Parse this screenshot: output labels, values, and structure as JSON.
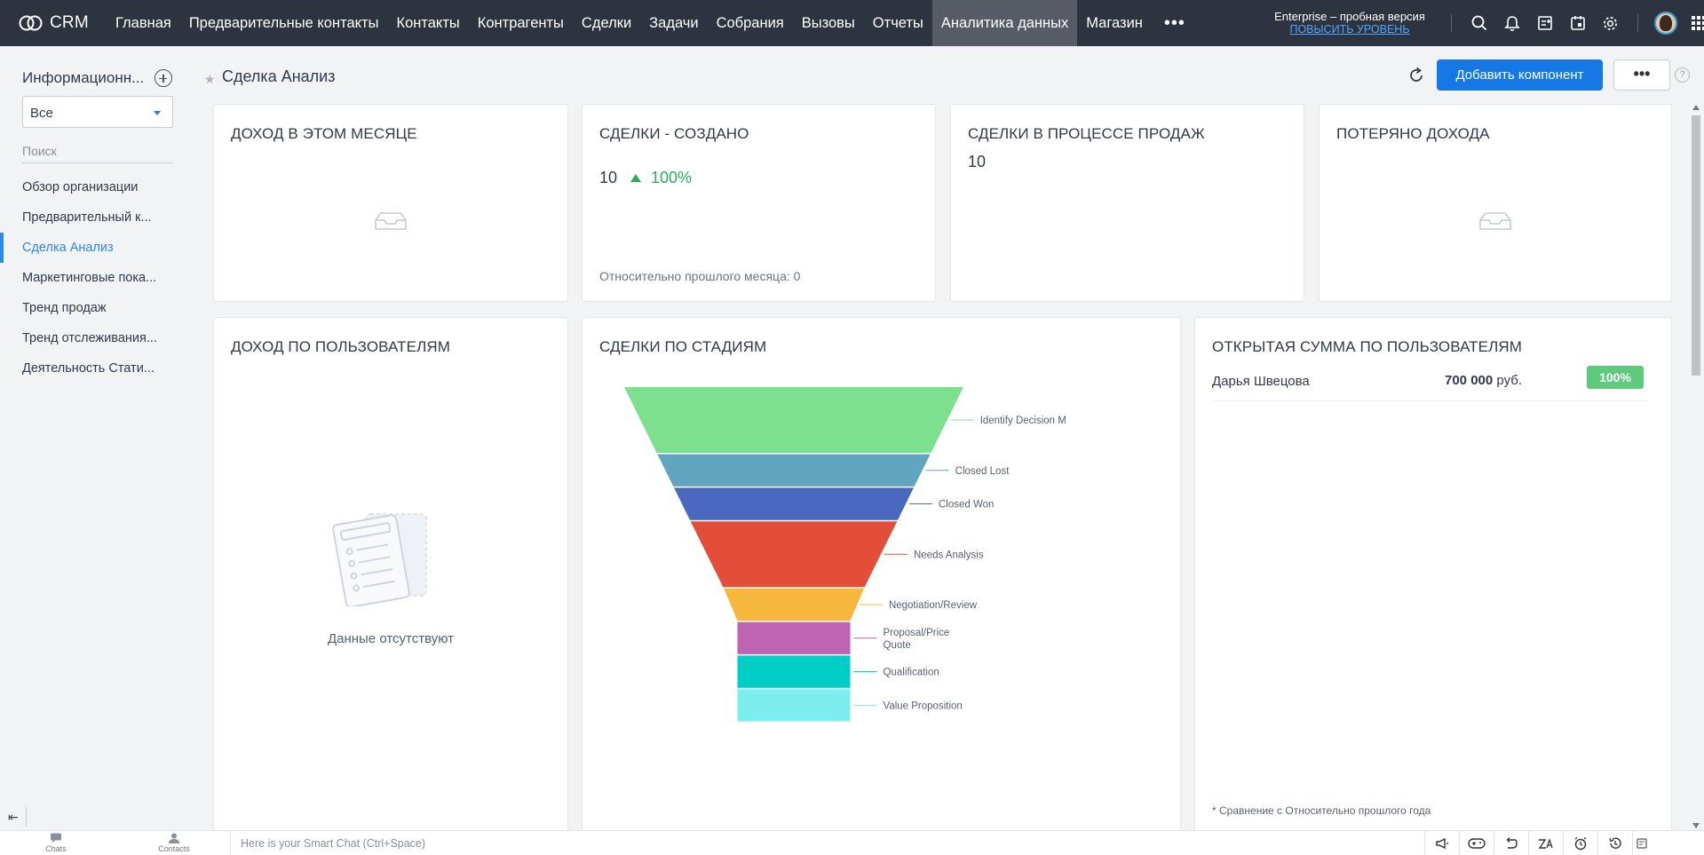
{
  "app": {
    "logo_text": "CRM"
  },
  "nav": {
    "items": [
      {
        "label": "Главная"
      },
      {
        "label": "Предварительные контакты"
      },
      {
        "label": "Контакты"
      },
      {
        "label": "Контрагенты"
      },
      {
        "label": "Сделки"
      },
      {
        "label": "Задачи"
      },
      {
        "label": "Собрания"
      },
      {
        "label": "Вызовы"
      },
      {
        "label": "Отчеты"
      },
      {
        "label": "Аналитика данных",
        "active": true
      },
      {
        "label": "Магазин"
      }
    ],
    "more_label": "•••"
  },
  "trial": {
    "title": "Enterprise – пробная версия",
    "upgrade_link": "ПОВЫСИТЬ УРОВЕНЬ"
  },
  "top_icons": [
    "search-icon",
    "bell-icon",
    "add-note-icon",
    "calendar-icon",
    "gear-icon",
    "avatar",
    "apps-grid-icon"
  ],
  "sidebar": {
    "title": "Информационн...",
    "filter_value": "Все",
    "search_placeholder": "Поиск",
    "items": [
      {
        "label": "Обзор организации"
      },
      {
        "label": "Предварительный к..."
      },
      {
        "label": "Сделка Анализ",
        "active": true
      },
      {
        "label": "Маркетинговые пока..."
      },
      {
        "label": "Тренд продаж"
      },
      {
        "label": "Тренд отслеживания..."
      },
      {
        "label": "Деятельность Стати..."
      }
    ],
    "collapse_label": "⇤"
  },
  "page": {
    "title": "Сделка Анализ",
    "add_component_label": "Добавить компонент",
    "more_label": "•••",
    "help_label": "?"
  },
  "cards": {
    "revenue_month": {
      "title": "ДОХОД В ЭТОМ МЕСЯЦЕ"
    },
    "deals_created": {
      "title": "СДЕЛКИ - СОЗДАНО",
      "value": "10",
      "change": "100%",
      "compare": "Относительно прошлого месяца: 0"
    },
    "deals_in_pipeline": {
      "title": "СДЕЛКИ В ПРОЦЕССЕ ПРОДАЖ",
      "value": "10"
    },
    "lost_revenue": {
      "title": "ПОТЕРЯНО ДОХОДА"
    },
    "revenue_by_user": {
      "title": "ДОХОД ПО ПОЛЬЗОВАТЕЛЯМ",
      "empty_text": "Данные отсутствуют"
    },
    "deals_by_stage": {
      "title": "СДЕЛКИ ПО СТАДИЯМ"
    },
    "open_amount_by_user": {
      "title": "ОТКРЫТАЯ СУММА ПО ПОЛЬЗОВАТЕЛЯМ",
      "rows": [
        {
          "name": "Дарья Швецова",
          "amount": "700 000",
          "currency": "руб.",
          "share": "100%"
        }
      ],
      "footnote": "* Сравнение с Относительно прошлого года"
    }
  },
  "chart_data": {
    "type": "funnel",
    "title": "СДЕЛКИ ПО СТАДИЯМ",
    "stages": [
      {
        "label": "Identify Decision M",
        "value": 2,
        "color": "#7ce08e"
      },
      {
        "label": "Closed Lost",
        "value": 1,
        "color": "#62a5c0"
      },
      {
        "label": "Closed Won",
        "value": 1,
        "color": "#4a69be"
      },
      {
        "label": "Needs Analysis",
        "value": 2,
        "color": "#e24e3a"
      },
      {
        "label": "Negotiation/Review",
        "value": 1,
        "color": "#f7b73d"
      },
      {
        "label": "Proposal/Price Quote",
        "value": 1,
        "color": "#bf63b3"
      },
      {
        "label": "Qualification",
        "value": 1,
        "color": "#00cdc5"
      },
      {
        "label": "Value Proposition",
        "value": 1,
        "color": "#7deded"
      }
    ]
  },
  "bottom_bar": {
    "chats_label": "Chats",
    "contacts_label": "Contacts",
    "smart_chat_placeholder": "Here is your Smart Chat (Ctrl+Space)",
    "icons": [
      "megaphone-icon",
      "gamepad-icon",
      "undo-icon",
      "translate-icon",
      "alarm-icon",
      "history-icon",
      "notes-icon"
    ]
  }
}
